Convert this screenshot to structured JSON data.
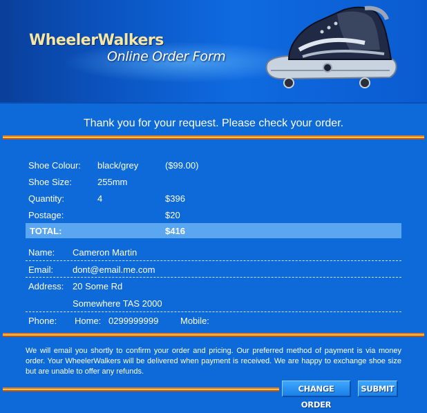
{
  "header": {
    "brand": "WheelerWalkers",
    "subtitle": "Online Order Form"
  },
  "thanks_message": "Thank you for your request. Please check your order.",
  "order": {
    "colour_label": "Shoe Colour:",
    "colour_value": "black/grey",
    "colour_price": "($99.00)",
    "size_label": "Shoe Size:",
    "size_value": "255mm",
    "quantity_label": "Quantity:",
    "quantity_value": "4",
    "quantity_price": "$396",
    "postage_label": "Postage:",
    "postage_price": "$20",
    "total_label": "TOTAL:",
    "total_price": "$416"
  },
  "customer": {
    "name_label": "Name:",
    "name_value": "Cameron Martin",
    "email_label": "Email:",
    "email_value": "dont@email.me.com",
    "address_label": "Address:",
    "address_line1": "20 Some Rd",
    "address_line2": "Somewhere TAS 2000",
    "phone_label": "Phone:",
    "home_label": "Home:",
    "home_value": "0299999999",
    "mobile_label": "Mobile:",
    "mobile_value": ""
  },
  "note": "We will email you shortly to confirm your order and pricing. Our preferred method of payment is via money order. Your WheelerWalkers will be delivered when payment is received. We are happy to exchange shoe size but are unable to offer any refunds.",
  "buttons": {
    "change_order": "CHANGE ORDER",
    "submit": "SUBMIT"
  },
  "colors": {
    "background": "#0d6ad8",
    "total_bar": "#5aa6f0",
    "brand_text": "#f4e7a6",
    "stripe_orange": "#e0792a"
  },
  "icons": {
    "banner_image": "wheeled-shoe-image"
  }
}
